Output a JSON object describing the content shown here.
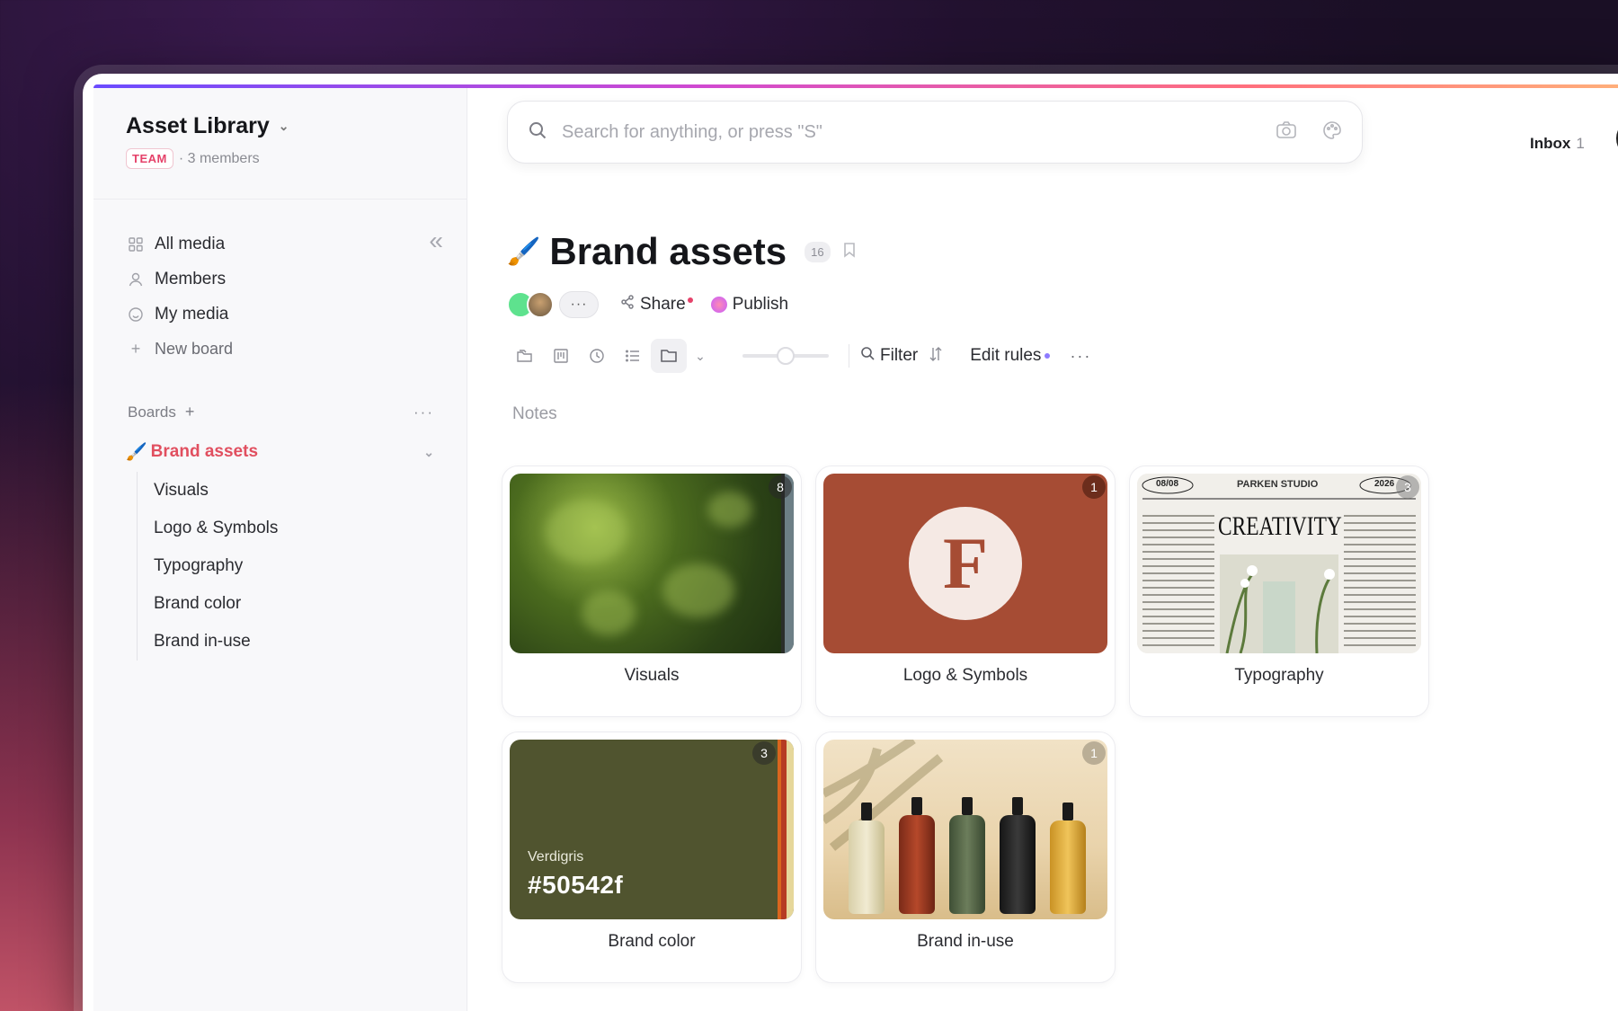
{
  "workspace": {
    "title": "Asset Library",
    "badge": "TEAM",
    "members": "· 3 members"
  },
  "nav": {
    "all_media": "All media",
    "members": "Members",
    "my_media": "My media",
    "new_board": "New board"
  },
  "boards": {
    "heading": "Boards",
    "active": "Brand assets",
    "items": [
      {
        "label": "Visuals"
      },
      {
        "label": "Logo & Symbols"
      },
      {
        "label": "Typography"
      },
      {
        "label": "Brand color"
      },
      {
        "label": "Brand in-use"
      }
    ]
  },
  "search": {
    "placeholder": "Search for anything, or press \"S\""
  },
  "inbox": {
    "label": "Inbox",
    "count": "1"
  },
  "board": {
    "title": "Brand assets",
    "count": "16",
    "share": "Share",
    "publish": "Publish",
    "filter": "Filter",
    "edit_rules": "Edit rules",
    "notes": "Notes",
    "more": "···"
  },
  "cards": [
    {
      "label": "Visuals",
      "count": "8"
    },
    {
      "label": "Logo & Symbols",
      "count": "1",
      "logo_letter": "F"
    },
    {
      "label": "Typography",
      "count": "3"
    },
    {
      "label": "Brand color",
      "count": "3",
      "color_name": "Verdigris",
      "color_hex": "#50542f"
    },
    {
      "label": "Brand in-use",
      "count": "1"
    }
  ],
  "typography_preview": {
    "date": "08/08",
    "studio": "PARKEN STUDIO",
    "year": "2026",
    "headline": "CREATIVITY"
  },
  "colors": {
    "accent": "#e14f5f",
    "brand_color": "#50542f",
    "logo_bg": "#a64c34"
  }
}
